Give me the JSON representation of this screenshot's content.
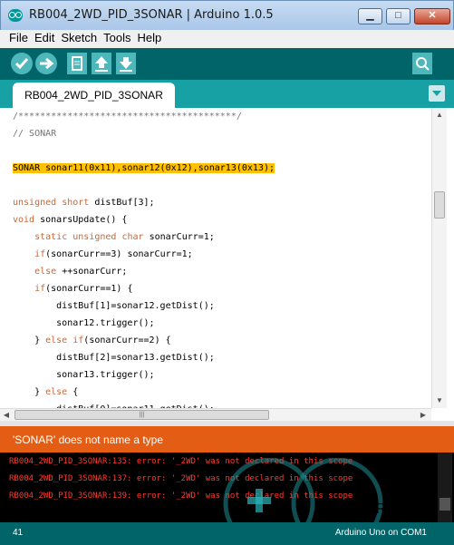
{
  "window": {
    "title": "RB004_2WD_PID_3SONAR | Arduino 1.0.5",
    "min_label": "▁",
    "max_label": "□",
    "close_label": "✕"
  },
  "menu": [
    "File",
    "Edit",
    "Sketch",
    "Tools",
    "Help"
  ],
  "toolbar": {
    "buttons": [
      "verify",
      "upload",
      "new",
      "open",
      "save"
    ],
    "serial_monitor": "serial-monitor"
  },
  "tab": {
    "label": "RB004_2WD_PID_3SONAR"
  },
  "code": [
    "/****************************************/",
    "// SONAR",
    "",
    "SONAR sonar11(0x11),sonar12(0x12),sonar13(0x13);",
    "",
    "unsigned short distBuf[3];",
    "void sonarsUpdate() {",
    "    static unsigned char sonarCurr=1;",
    "    if(sonarCurr==3) sonarCurr=1;",
    "    else ++sonarCurr;",
    "    if(sonarCurr==1) {",
    "        distBuf[1]=sonar12.getDist();",
    "        sonar12.trigger();",
    "    } else if(sonarCurr==2) {",
    "        distBuf[2]=sonar13.getDist();",
    "        sonar13.trigger();",
    "    } else {",
    "        distBuf[0]=sonar11.getDist();"
  ],
  "highlighted_line": 3,
  "status": {
    "error_message": "'SONAR' does not name a type"
  },
  "console": [
    "RB004_2WD_PID_3SONAR:135: error: '_2WD' was not declared in this scope",
    "RB004_2WD_PID_3SONAR:137: error: '_2WD' was not declared in this scope",
    "RB004_2WD_PID_3SONAR:139: error: '_2WD' was not declared in this scope"
  ],
  "bottom": {
    "line_number": "41",
    "board": "Arduino Uno on COM1"
  },
  "watermark": {
    "text": "ARDUINO"
  },
  "colors": {
    "toolbar": "#006468",
    "tab_row": "#17a1a5",
    "error_bar": "#e35e14",
    "highlight": "#ffc000",
    "console_text": "#ff3a2a"
  }
}
